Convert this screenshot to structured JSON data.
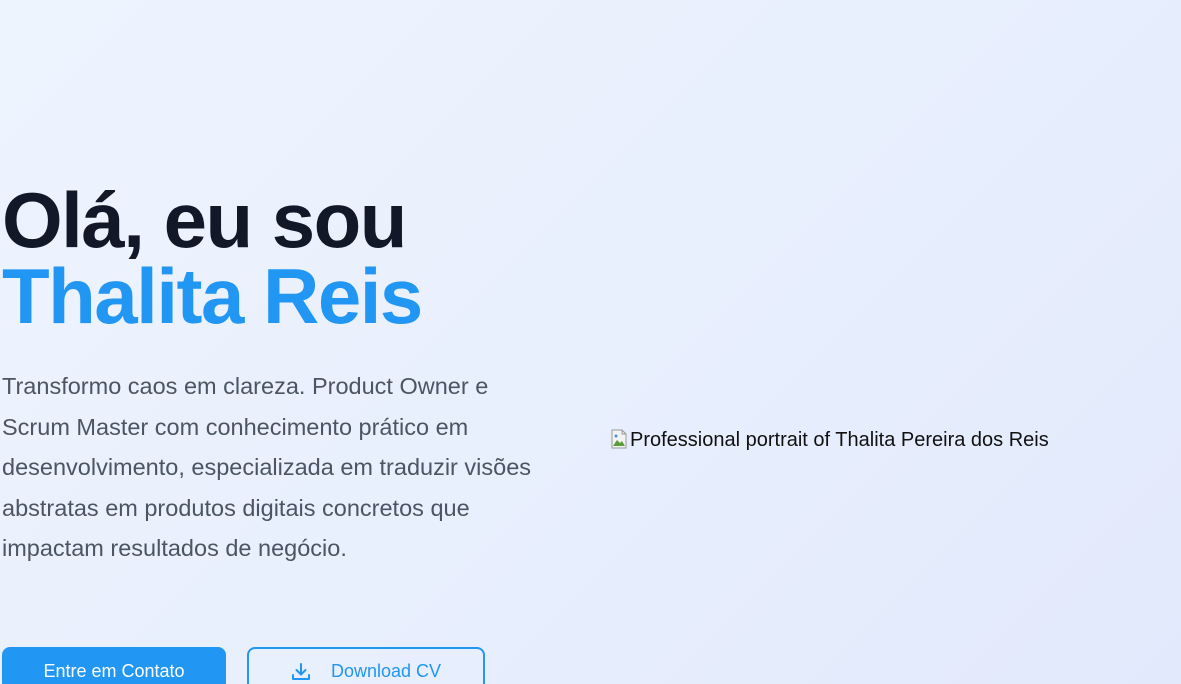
{
  "hero": {
    "greeting": "Olá, eu sou",
    "name": "Thalita Reis",
    "description": "Transformo caos em clareza. Product Owner e Scrum Master com conhecimento prático em desenvolvimento, especializada em traduzir visões abstratas em produtos digitais concretos que impactam resultados de negócio.",
    "primary_button": "Entre em Contato",
    "secondary_button": "Download CV",
    "secondary_button_icon": "download-icon"
  },
  "portrait": {
    "alt_text": "Professional portrait of Thalita Pereira dos Reis",
    "icon": "broken-image-icon"
  },
  "colors": {
    "accent": "#2196f3",
    "heading": "#111827",
    "body_text": "#4b5563"
  }
}
